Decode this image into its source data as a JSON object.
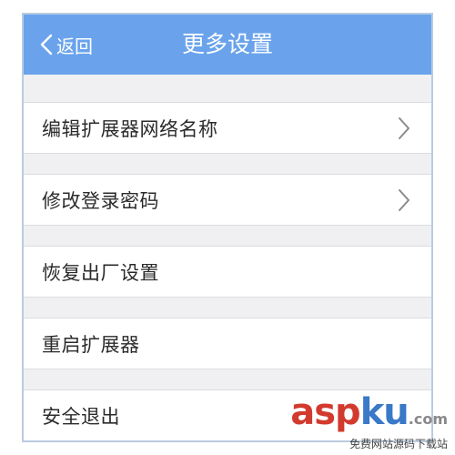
{
  "header": {
    "back_label": "返回",
    "title": "更多设置"
  },
  "items": [
    {
      "label": "编辑扩展器网络名称",
      "has_chevron": true
    },
    {
      "label": "修改登录密码",
      "has_chevron": true
    },
    {
      "label": "恢复出厂设置",
      "has_chevron": false
    },
    {
      "label": "重启扩展器",
      "has_chevron": false
    },
    {
      "label": "安全退出",
      "has_chevron": false
    }
  ],
  "watermark": {
    "main_prefix": "asp",
    "main_accent": "ku",
    "main_suffix": ".com",
    "sub": "免费网站源码下载站"
  },
  "colors": {
    "header_bg": "#6aa3ec",
    "background": "#f0f0f3",
    "row_bg": "#ffffff"
  }
}
